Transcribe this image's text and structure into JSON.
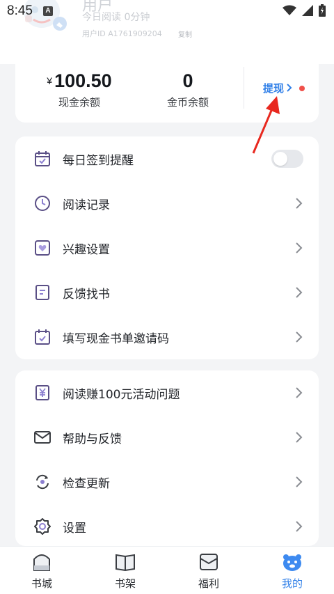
{
  "status_bar": {
    "time": "8:45",
    "indicator": "A"
  },
  "profile": {
    "name": "用户",
    "read_time": "今日阅读 0分钟",
    "user_id": "用户ID A1761909204",
    "copy_label": "复制"
  },
  "balance": {
    "currency_symbol": "¥",
    "cash_value": "100.50",
    "cash_label": "现金余额",
    "coin_value": "0",
    "coin_label": "金币余额",
    "withdraw_label": "提现"
  },
  "menu_group_1": [
    {
      "label": "每日签到提醒",
      "icon": "calendar-check-icon",
      "control": "toggle",
      "toggle_on": false
    },
    {
      "label": "阅读记录",
      "icon": "clock-icon",
      "control": "chevron"
    },
    {
      "label": "兴趣设置",
      "icon": "heart-icon",
      "control": "chevron"
    },
    {
      "label": "反馈找书",
      "icon": "document-icon",
      "control": "chevron"
    },
    {
      "label": "填写现金书单邀请码",
      "icon": "calendar-check-icon",
      "control": "chevron"
    }
  ],
  "menu_group_2": [
    {
      "label": "阅读赚100元活动问题",
      "icon": "yuan-doc-icon",
      "control": "chevron"
    },
    {
      "label": "帮助与反馈",
      "icon": "mail-icon",
      "control": "chevron"
    },
    {
      "label": "检查更新",
      "icon": "refresh-icon",
      "control": "chevron"
    },
    {
      "label": "设置",
      "icon": "gear-icon",
      "control": "chevron"
    }
  ],
  "bottom_nav": [
    {
      "label": "书城",
      "icon": "bookstore-icon",
      "active": false
    },
    {
      "label": "书架",
      "icon": "bookshelf-icon",
      "active": false
    },
    {
      "label": "福利",
      "icon": "gift-icon",
      "active": false
    },
    {
      "label": "我的",
      "icon": "profile-bear-icon",
      "active": true
    }
  ],
  "colors": {
    "accent": "#2f7fe8",
    "page_background": "#f3f4f6",
    "icon_purple": "#5a4f86",
    "red_dot": "#f0504a",
    "annotation_arrow": "#e8281f"
  }
}
